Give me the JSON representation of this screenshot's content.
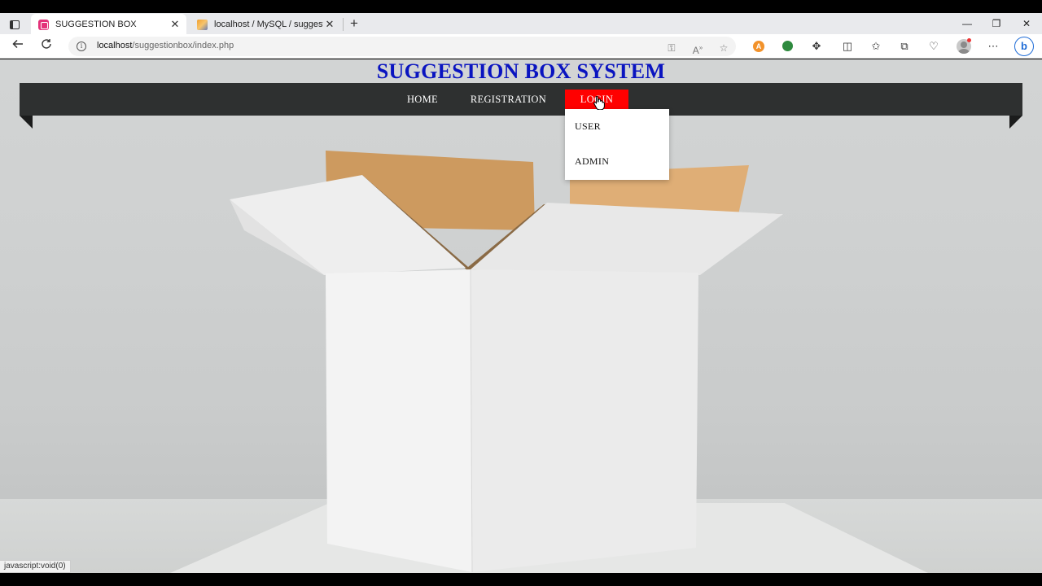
{
  "browser": {
    "tabs": [
      {
        "title": "SUGGESTION BOX",
        "active": true
      },
      {
        "title": "localhost / MySQL / suggestionb",
        "active": false
      }
    ],
    "new_tab": "+",
    "close_glyph": "✕",
    "window_controls": {
      "minimize": "—",
      "restore": "❐",
      "close": "✕"
    },
    "url": {
      "host": "localhost",
      "path": "/suggestionbox/index.php"
    },
    "status_text": "javascript:void(0)"
  },
  "site": {
    "title": "SUGGESTION BOX SYSTEM",
    "nav": [
      {
        "label": "HOME"
      },
      {
        "label": "REGISTRATION"
      },
      {
        "label": "LOGIN"
      }
    ],
    "login_menu": [
      {
        "label": "USER"
      },
      {
        "label": "ADMIN"
      }
    ]
  },
  "colors": {
    "title": "#0a14c0",
    "nav_bg": "#2e3030",
    "login_active": "#ff0000",
    "dropdown_bg": "#ffffff"
  },
  "icons": {
    "back": "arrow-left-icon",
    "refresh": "refresh-icon",
    "info": "info-icon",
    "favorites": "star-icon",
    "extensions": "puzzle-icon",
    "split": "split-screen-icon",
    "collections": "collections-icon",
    "more": "more-icon",
    "copilot": "bing-icon"
  }
}
